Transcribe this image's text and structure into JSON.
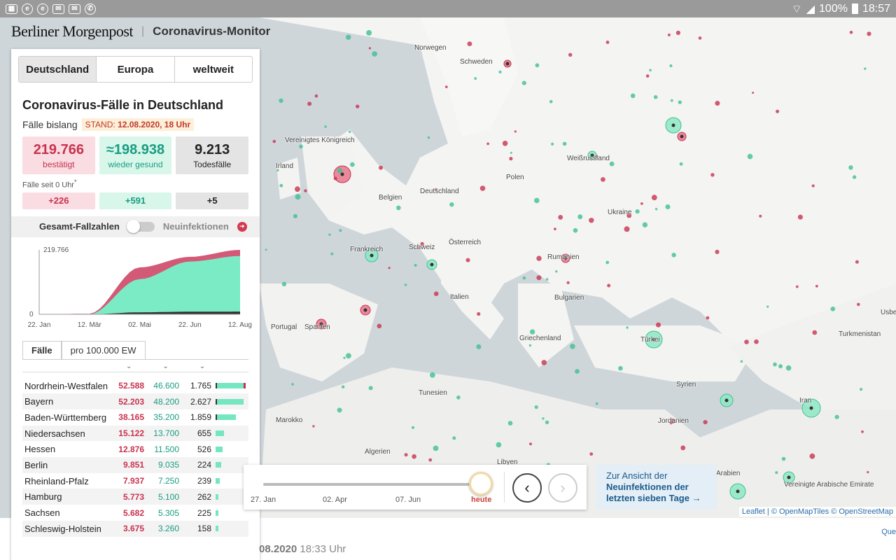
{
  "status_bar": {
    "battery": "100%",
    "time": "18:57"
  },
  "header": {
    "brand": "Berliner Morgenpost",
    "title": "Coronavirus-Monitor"
  },
  "tabs": [
    "Deutschland",
    "Europa",
    "weltweit"
  ],
  "panel": {
    "title": "Coronavirus-Fälle in Deutschland",
    "subtitle": "Fälle bislang",
    "stand_prefix": "STAND: ",
    "stand_date": "12.08.2020, 18 Uhr",
    "confirmed": {
      "value": "219.766",
      "label": "bestätigt"
    },
    "recovered": {
      "value": "≈198.938",
      "label": "wieder gesund"
    },
    "deaths": {
      "value": "9.213",
      "label": "Todesfälle"
    },
    "since_label": "Fälle seit 0 Uhr",
    "since_mark": "*",
    "delta_confirmed": "+226",
    "delta_recovered": "+591",
    "delta_deaths": "+5",
    "toggle_left": "Gesamt-Fallzahlen",
    "toggle_right": "Neuinfektionen",
    "subtabs": [
      "Fälle",
      "pro 100.000 EW"
    ]
  },
  "chart_data": {
    "type": "area",
    "x": [
      "22. Jan",
      "12. Mär",
      "02. Mai",
      "22. Jun",
      "12. Aug"
    ],
    "ymax_label": "219.766",
    "ymin_label": "0",
    "series": [
      {
        "values": [
          0,
          2000,
          160000,
          196000,
          219766
        ]
      },
      {
        "values": [
          0,
          0,
          120000,
          180000,
          198938
        ]
      },
      {
        "values": [
          0,
          0,
          6800,
          8900,
          9213
        ]
      }
    ],
    "colors": {
      "confirmed": "#d35a76",
      "recovered": "#7aebc5",
      "deaths": "#333333"
    }
  },
  "table": {
    "rows": [
      {
        "name": "Nordrhein-Westfalen",
        "confirmed": "52.588",
        "recovered": "46.600",
        "deaths": "1.765",
        "bar": 1.0
      },
      {
        "name": "Bayern",
        "confirmed": "52.203",
        "recovered": "48.200",
        "deaths": "2.627",
        "bar": 0.99
      },
      {
        "name": "Baden-Württemberg",
        "confirmed": "38.165",
        "recovered": "35.200",
        "deaths": "1.859",
        "bar": 0.73
      },
      {
        "name": "Niedersachsen",
        "confirmed": "15.122",
        "recovered": "13.700",
        "deaths": "655",
        "bar": 0.29
      },
      {
        "name": "Hessen",
        "confirmed": "12.876",
        "recovered": "11.500",
        "deaths": "526",
        "bar": 0.24
      },
      {
        "name": "Berlin",
        "confirmed": "9.851",
        "recovered": "9.035",
        "deaths": "224",
        "bar": 0.19
      },
      {
        "name": "Rheinland-Pfalz",
        "confirmed": "7.937",
        "recovered": "7.250",
        "deaths": "239",
        "bar": 0.15
      },
      {
        "name": "Hamburg",
        "confirmed": "5.773",
        "recovered": "5.100",
        "deaths": "262",
        "bar": 0.11
      },
      {
        "name": "Sachsen",
        "confirmed": "5.682",
        "recovered": "5.305",
        "deaths": "225",
        "bar": 0.11
      },
      {
        "name": "Schleswig-Holstein",
        "confirmed": "3.675",
        "recovered": "3.260",
        "deaths": "158",
        "bar": 0.07
      }
    ]
  },
  "map": {
    "labels": [
      "Norwegen",
      "Schweden",
      "Vereinigtes Königreich",
      "Irland",
      "Weißrussland",
      "Polen",
      "Deutschland",
      "Belgien",
      "Ukraine",
      "Frankreich",
      "Schweiz",
      "Österreich",
      "Rumänien",
      "Italien",
      "Bulgarien",
      "Portugal",
      "Spanien",
      "Griechenland",
      "Türkei",
      "Turkmenistan",
      "Tunesien",
      "Syrien",
      "Marokko",
      "Jordanien",
      "Iran",
      "Algerien",
      "Libyen",
      "Arabien",
      "Vereinigte Arabische Emirate",
      "Usbe"
    ]
  },
  "timeline": {
    "dates": [
      "27. Jan",
      "02. Apr",
      "07. Jun",
      "heute"
    ],
    "position": 1.0
  },
  "new_infections_link": {
    "line1": "Zur Ansicht der",
    "line2": "Neuinfektionen der",
    "line3": "letzten sieben Tage →"
  },
  "attribution": {
    "leaflet": "Leaflet",
    "rest": " | © OpenMapTiles © OpenStreetMap"
  },
  "footer": {
    "date": "08.2020",
    "time": "18:33 Uhr",
    "corner": "Que"
  }
}
